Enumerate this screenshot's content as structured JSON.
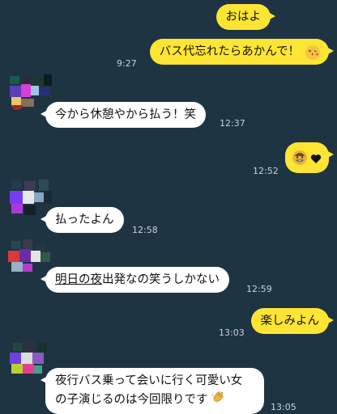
{
  "messages": [
    {
      "text": "おはよ",
      "sender": "me"
    },
    {
      "text": "バス代忘れたらあかんで！",
      "emoji": "kiss-face-icon",
      "sender": "me",
      "time": "9:27"
    },
    {
      "text": "今から休憩やから払う！笑",
      "sender": "friend",
      "time": "12:37"
    },
    {
      "emoji": [
        "grinning-face-icon",
        "heart-icon"
      ],
      "sender": "me",
      "time": "12:52"
    },
    {
      "text": "払ったよん",
      "sender": "friend",
      "time": "12:58"
    },
    {
      "text_underlined": "明日の夜",
      "text_rest": "出発なの笑うしかない",
      "sender": "friend",
      "time": "12:59"
    },
    {
      "text": "楽しみよん",
      "sender": "me",
      "time": "13:03"
    },
    {
      "text_line1": "夜行バス乗って会いに行く可愛い女",
      "text_line2": "の子演じるのは今回限りです",
      "emoji": "clapping-hand-icon",
      "sender": "friend",
      "time": "13:05"
    }
  ],
  "colors": {
    "background": "#1f3442",
    "outgoing_bubble": "#ffe533",
    "incoming_bubble": "#ffffff",
    "timestamp": "#c9d2d8"
  }
}
